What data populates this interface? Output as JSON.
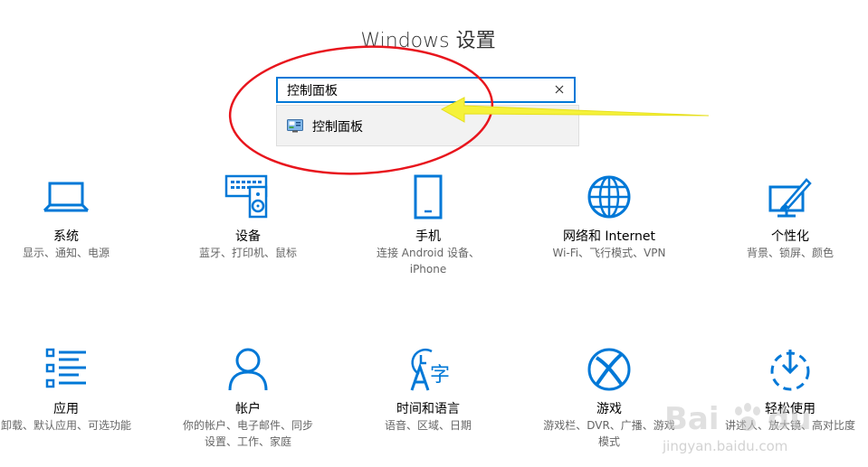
{
  "header": {
    "title": "Windows 设置"
  },
  "search": {
    "value": "控制面板",
    "suggestion": "控制面板",
    "clear_icon": "close-icon"
  },
  "tiles": [
    {
      "name": "系统",
      "desc1": "显示、通知、电源",
      "desc2": "",
      "icon": "laptop-icon"
    },
    {
      "name": "设备",
      "desc1": "蓝牙、打印机、鼠标",
      "desc2": "",
      "icon": "keyboard-speaker-icon"
    },
    {
      "name": "手机",
      "desc1": "连接 Android 设备、",
      "desc2": "iPhone",
      "icon": "phone-icon"
    },
    {
      "name": "网络和 Internet",
      "desc1": "Wi-Fi、飞行模式、VPN",
      "desc2": "",
      "icon": "globe-icon"
    },
    {
      "name": "个性化",
      "desc1": "背景、锁屏、颜色",
      "desc2": "",
      "icon": "paint-brush-icon"
    },
    {
      "name": "应用",
      "desc1": "卸载、默认应用、可选功能",
      "desc2": "",
      "icon": "apps-list-icon"
    },
    {
      "name": "帐户",
      "desc1": "你的帐户、电子邮件、同步",
      "desc2": "设置、工作、家庭",
      "icon": "person-icon"
    },
    {
      "name": "时间和语言",
      "desc1": "语音、区域、日期",
      "desc2": "",
      "icon": "clock-language-icon"
    },
    {
      "name": "游戏",
      "desc1": "游戏栏、DVR、广播、游戏",
      "desc2": "模式",
      "icon": "xbox-icon"
    },
    {
      "name": "轻松使用",
      "desc1": "讲述人、放大镜、高对比度",
      "desc2": "",
      "icon": "ease-of-access-icon"
    }
  ],
  "watermark": {
    "brand": "Bai du",
    "sub": "jingyan.baidu.com"
  },
  "colors": {
    "accent": "#0078d7",
    "annotation_red": "#e8151d",
    "annotation_yellow": "#f5f23a"
  }
}
